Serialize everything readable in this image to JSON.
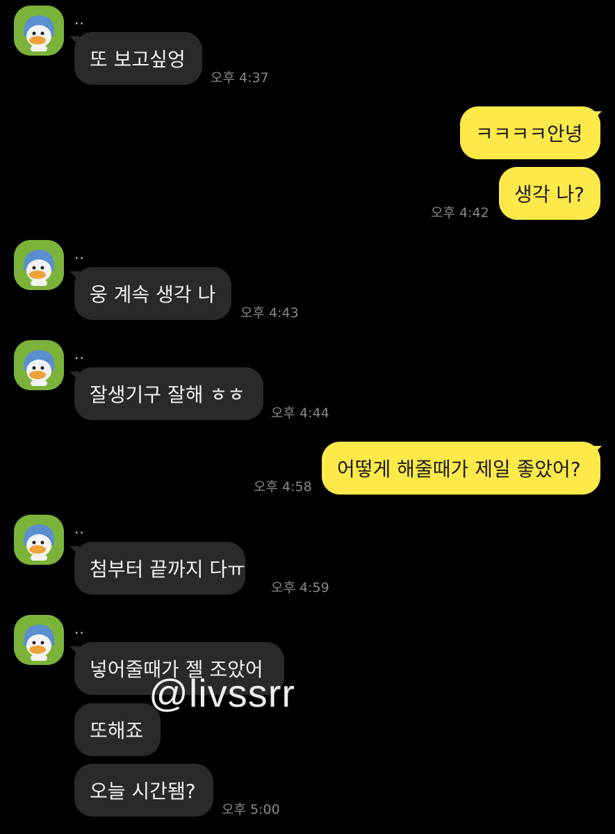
{
  "chat": {
    "sender_name": "..",
    "watermark": "@livssrr",
    "messages": [
      {
        "dir": "in",
        "text": "또 보고싶엉",
        "time": "오후 4:37"
      },
      {
        "dir": "out",
        "text": "ㅋㅋㅋㅋ안녕",
        "time": ""
      },
      {
        "dir": "out",
        "text": "생각 나?",
        "time": "오후 4:42"
      },
      {
        "dir": "in",
        "text": "웅 계속 생각 나",
        "time": "오후 4:43"
      },
      {
        "dir": "in",
        "text": "잘생기구 잘해 ㅎㅎ",
        "time": "오후 4:44"
      },
      {
        "dir": "out",
        "text": "어떻게 해줄때가 제일 좋았어?",
        "time": "오후 4:58"
      },
      {
        "dir": "in",
        "text": "첨부터 끝까지 다ㅠ",
        "time": "오후 4:59"
      },
      {
        "dir": "in",
        "text": "넣어줄때가 젤 조았어",
        "time": ""
      },
      {
        "dir": "in",
        "text": "또해죠",
        "time": ""
      },
      {
        "dir": "in",
        "text": "오늘 시간됌?",
        "time": "오후 5:00"
      }
    ]
  },
  "colors": {
    "background": "#000000",
    "incoming_bubble": "#2a2a2c",
    "outgoing_bubble": "#fde94a",
    "avatar": "#7bb33a"
  },
  "icons": {
    "avatar": "duck-avatar-icon"
  }
}
